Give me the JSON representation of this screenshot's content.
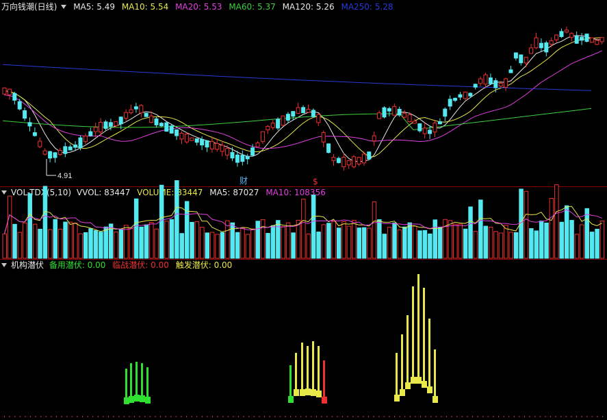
{
  "panels": {
    "price": {
      "title": "万向钱潮(日线)",
      "ma": [
        {
          "label": "MA5:",
          "value": "5.49",
          "color": "#e8e8e8"
        },
        {
          "label": "MA10:",
          "value": "5.54",
          "color": "#e8e84a"
        },
        {
          "label": "MA20:",
          "value": "5.53",
          "color": "#e040e0"
        },
        {
          "label": "MA60:",
          "value": "5.37",
          "color": "#40d040"
        },
        {
          "label": "MA120:",
          "value": "5.26",
          "color": "#e8e8e8"
        },
        {
          "label": "MA250:",
          "value": "5.28",
          "color": "#2a3ad8"
        }
      ],
      "low_marker": "4.91",
      "events": [
        {
          "label": "财",
          "color": "#54b4f0"
        },
        {
          "label": "$",
          "color": "#f03030"
        }
      ]
    },
    "volume": {
      "title": "VOL-TDX(5,10)",
      "fields": [
        {
          "label": "VVOL:",
          "value": "83447",
          "color": "#e8e8e8"
        },
        {
          "label": "VOLUME:",
          "value": "83447",
          "color": "#e8e84a"
        },
        {
          "label": "MA5:",
          "value": "87027",
          "color": "#e8e8e8"
        },
        {
          "label": "MA10:",
          "value": "108356",
          "color": "#e040e0"
        }
      ]
    },
    "indicator": {
      "title": "机构潜伏",
      "fields": [
        {
          "label": "备用潜伏:",
          "value": "0.00",
          "color": "#30e030"
        },
        {
          "label": "临战潜伏:",
          "value": "0.00",
          "color": "#f03030"
        },
        {
          "label": "触发潜伏:",
          "value": "0.00",
          "color": "#e8e84a"
        }
      ]
    }
  },
  "colors": {
    "up": "#f03030",
    "down": "#54e8f0",
    "ma5": "#e8e8e8",
    "ma10": "#e8e84a",
    "ma20": "#e040e0",
    "ma60": "#40d040",
    "ma250": "#2a3ad8",
    "grid": "#8b0000"
  }
}
